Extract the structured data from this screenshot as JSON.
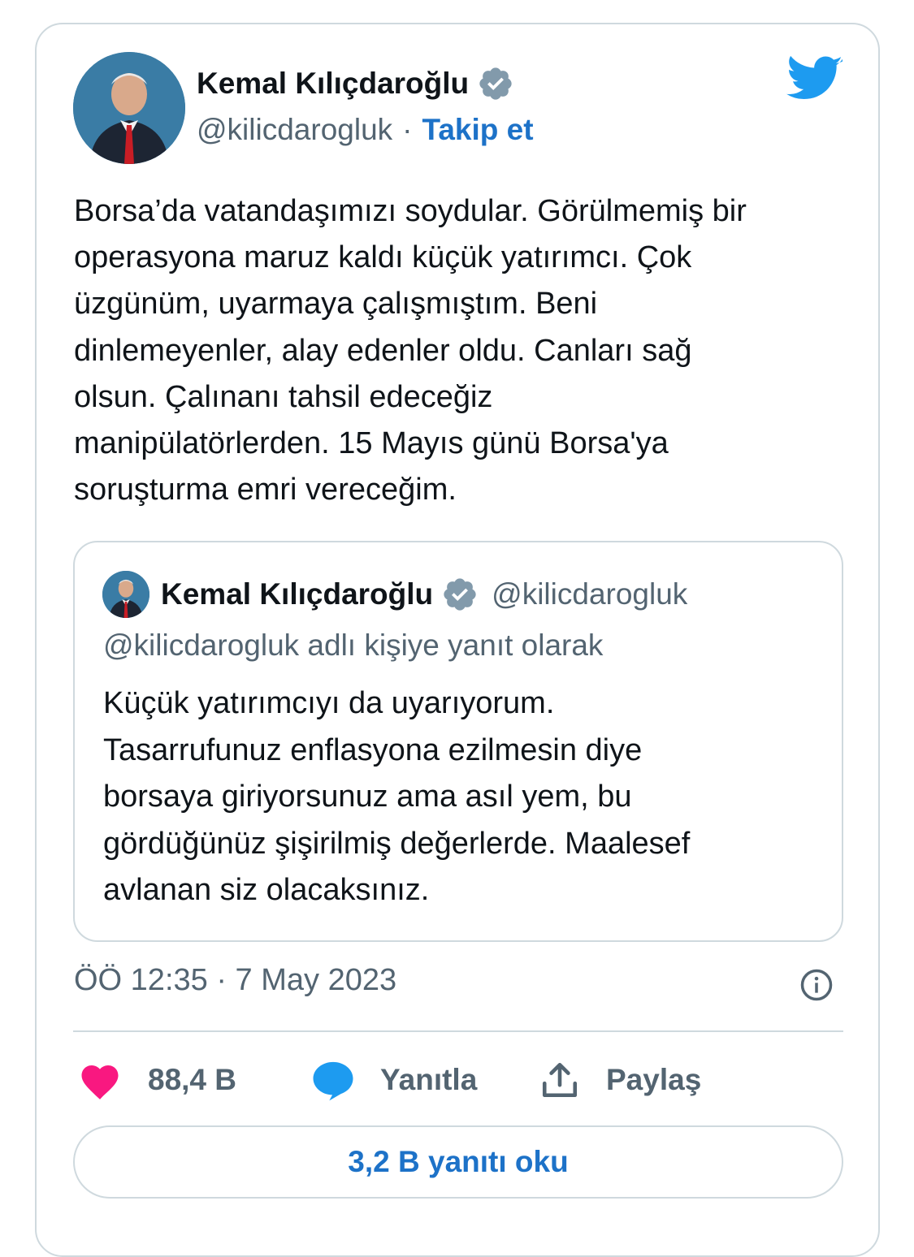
{
  "tweet": {
    "author_name": "Kemal Kılıçdaroğlu",
    "author_handle": "@kilicdarogluk",
    "separator": "·",
    "follow_label": "Takip et",
    "text": "Borsa’da vatandaşımızı soydular. Görülmemiş bir\noperasyona maruz kaldı küçük yatırımcı. Çok\nüzgünüm, uyarmaya çalışmıştım. Beni\ndinlemeyenler, alay edenler oldu. Canları sağ\nolsun. Çalınanı tahsil edeceğiz\nmanipülatörlerden. 15 Mayıs günü Borsa'ya\nsoruşturma emri vereceğim.",
    "timestamp": "ÖÖ 12:35 · 7 May 2023"
  },
  "quoted_tweet": {
    "author_name": "Kemal Kılıçdaroğlu",
    "author_handle": "@kilicdarogluk",
    "reply_context": "@kilicdarogluk adlı kişiye yanıt olarak",
    "text": "Küçük yatırımcıyı da uyarıyorum.\nTasarrufunuz enflasyona ezilmesin diye\nborsaya giriyorsunuz ama asıl yem, bu\ngördüğünüz şişirilmiş değerlerde. Maalesef\navlanan siz olacaksınız."
  },
  "actions": {
    "likes": "88,4 B",
    "reply_label": "Yanıtla",
    "share_label": "Paylaş"
  },
  "read_replies_label": "3,2 B yanıtı oku",
  "colors": {
    "accent": "#1d72c8",
    "like": "#f91880",
    "reply": "#1d9bf0",
    "muted": "#536471",
    "border": "#cfd9de",
    "twitter": "#1d9bf0"
  },
  "icons": [
    "twitter-bird-icon",
    "verified-badge-icon",
    "info-icon",
    "heart-icon",
    "reply-bubble-icon",
    "share-icon"
  ]
}
